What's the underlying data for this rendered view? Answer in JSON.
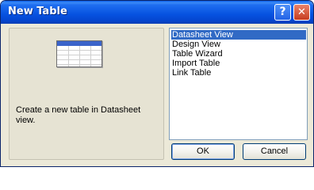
{
  "window": {
    "title": "New Table",
    "help_button": "?",
    "close_button": "✕"
  },
  "preview": {
    "icon": "table-icon",
    "description": "Create a new table in Datasheet view."
  },
  "list": {
    "items": [
      {
        "label": "Datasheet View",
        "selected": true
      },
      {
        "label": "Design View",
        "selected": false
      },
      {
        "label": "Table Wizard",
        "selected": false
      },
      {
        "label": "Import Table",
        "selected": false
      },
      {
        "label": "Link Table",
        "selected": false
      }
    ]
  },
  "buttons": {
    "ok": "OK",
    "cancel": "Cancel"
  },
  "colors": {
    "titlebar": "#0652e0",
    "selection": "#316ac5",
    "dialog_bg": "#ece9d8"
  }
}
